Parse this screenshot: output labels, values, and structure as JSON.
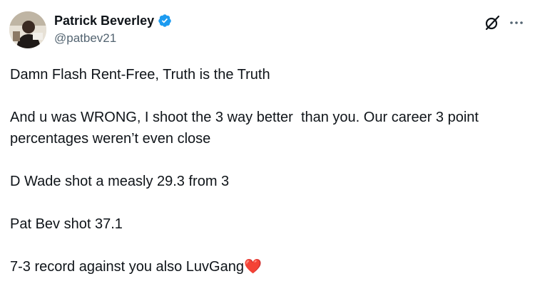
{
  "author": {
    "display_name": "Patrick Beverley",
    "handle": "@patbev21",
    "verified_icon": "verified-badge-icon"
  },
  "header_icons": {
    "grok": "grok-icon",
    "more": "more-options-icon"
  },
  "tweet": {
    "paragraphs": [
      "Damn Flash Rent-Free, Truth is the Truth",
      "And u was WRONG, I shoot the 3 way better  than you. Our career 3 point percentages weren’t even close",
      "D Wade shot a measly 29.3 from 3",
      "Pat Bev shot 37.1",
      "7-3 record against you also LuvGang"
    ],
    "emoji": "❤️"
  },
  "colors": {
    "text": "#0f1419",
    "secondary": "#536471",
    "verified": "#1d9bf0",
    "heart": "#e0245e"
  }
}
